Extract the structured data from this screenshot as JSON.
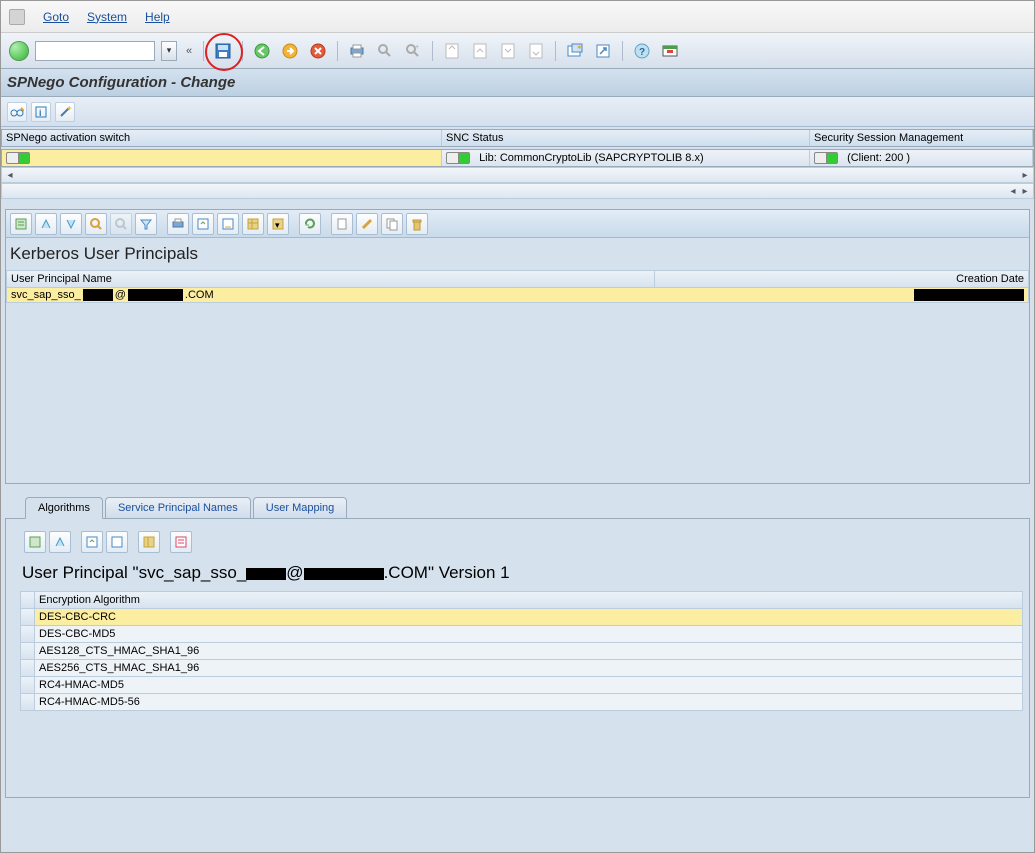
{
  "menu": {
    "goto": "Goto",
    "system": "System",
    "help": "Help"
  },
  "title": "SPNego Configuration - Change",
  "status": {
    "col1_hdr": "SPNego activation switch",
    "col2_hdr": "SNC Status",
    "col3_hdr": "Security Session Management",
    "col1_val": "",
    "col2_val": "Lib: CommonCryptoLib (SAPCRYPTOLIB 8.x)",
    "col3_val": "  (Client: 200 )"
  },
  "principals": {
    "section_title": "Kerberos User Principals",
    "col_upn": "User Principal Name",
    "col_date": "Creation Date",
    "row_prefix": "svc_sap_sso_",
    "row_at": "@",
    "row_suffix": ".COM"
  },
  "tabs": {
    "algorithms": "Algorithms",
    "spn": "Service Principal Names",
    "usermap": "User Mapping"
  },
  "algorithms": {
    "title_pre": "User Principal \"svc_sap_sso_",
    "title_at": "@",
    "title_suf": ".COM\" Version 1",
    "col": "Encryption Algorithm",
    "rows": [
      "DES-CBC-CRC",
      "DES-CBC-MD5",
      "AES128_CTS_HMAC_SHA1_96",
      "AES256_CTS_HMAC_SHA1_96",
      "RC4-HMAC-MD5",
      "RC4-HMAC-MD5-56"
    ]
  }
}
